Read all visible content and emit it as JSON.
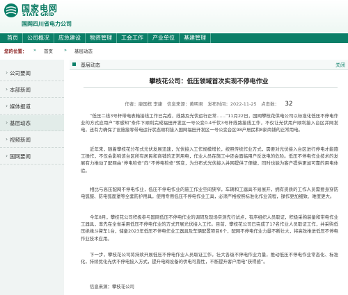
{
  "header": {
    "logo_cn": "国家电网",
    "logo_en": "STATE GRID",
    "logo_sub": "国网四川省电力公司",
    "brand_color": "#0b7f68"
  },
  "nav": {
    "items": [
      "首页",
      "公司概况",
      "应急建设",
      "物资管理",
      "工会工作",
      "产业单位",
      "基建管理"
    ]
  },
  "breadcrumb": {
    "label": "您的位置：",
    "items": [
      "首页",
      "基层动态"
    ]
  },
  "sidebar": {
    "items": [
      "公司要闻",
      "本部新闻",
      "媒体报道",
      "基层动态",
      "视频新闻",
      "国网要闻"
    ],
    "active_index": 3
  },
  "category": {
    "title": "基层动态",
    "back": "关闭"
  },
  "article": {
    "title": "攀枝花公司：低压领域首次实现不停电作业",
    "meta": "作者：康国栋 李康　信息来源：黄明君　发布时间：2022-11-25　点击数：",
    "views": "32",
    "paragraphs": [
      "“低压二线3号杆带电表箱接线工作已完成，线路及光伏运行正常……”11月22日，国网攀枝花供电公司以标准化低压不停电作业的方式应用户“零感知”条件下顺利完成福田开发区一号公变0.4千伏3号杆线路接线工作，不仅让光伏用户顺利接入台区并网发电，还有力确保了设施接零带电运行状态顺利接入国网福田开发区一号公变台区98户居民和8家商铺的正常用电。",
      "近年来，随着攀枝花分布式光伏发展迅速，光伏接入工作规模增长，按照传统作业方式，需要对光伏接入台区进行停电才能施工操作，不仅会影响该台区所有居民和商铺的正常用电，作业人员在施工中还会面临用户反送电的危险。低压不停电作业技术的发展有力推动了配网由“停电检修”向“不停电检修”转变，为分布式光伏接入并网提供了便捷，同时也能为客户提供更加可靠的用电体验。",
      "相比与高压配网不停电作业，低压不停电作业的施工作业空间狭窄，车辆和工器具不易展开，拥有资质的工作人员需要身穿防电弧服、防电弧面罩等全套防护用具，使用专用低压不停电作业工具，必须严格按照标准化作业流程，操作更加细致、难度更大。",
      "今年8月，攀枝花公司积极参与国网低压不停电作业的调研及现场实测先行试点，有序组织人员取证，积极采购装备和带电作业工器具，率先在全省采用低压不停电作业的方式开展光伏接入工作。目前，攀枝花公司已完成了17名作业人员取证工作，并采购低压绝缘斗臂车1台，储备2023年低压不停电作业工器具及车辆配置项目6个，配网不停电作业力量不断壮大，将高效推进低压不停电作业技术应用。",
      "下一步，攀枝花公司将持续开展低压不停电作业人员取证工作，壮大各级不停电作业力量，推动低压不停电作业常态化、标准化，持续优化光伏不停电接入方式，提升电网设备的供电可靠性，不断提升客户用电“获得感”。"
    ],
    "source": "信息来源：攀枝花公司"
  }
}
